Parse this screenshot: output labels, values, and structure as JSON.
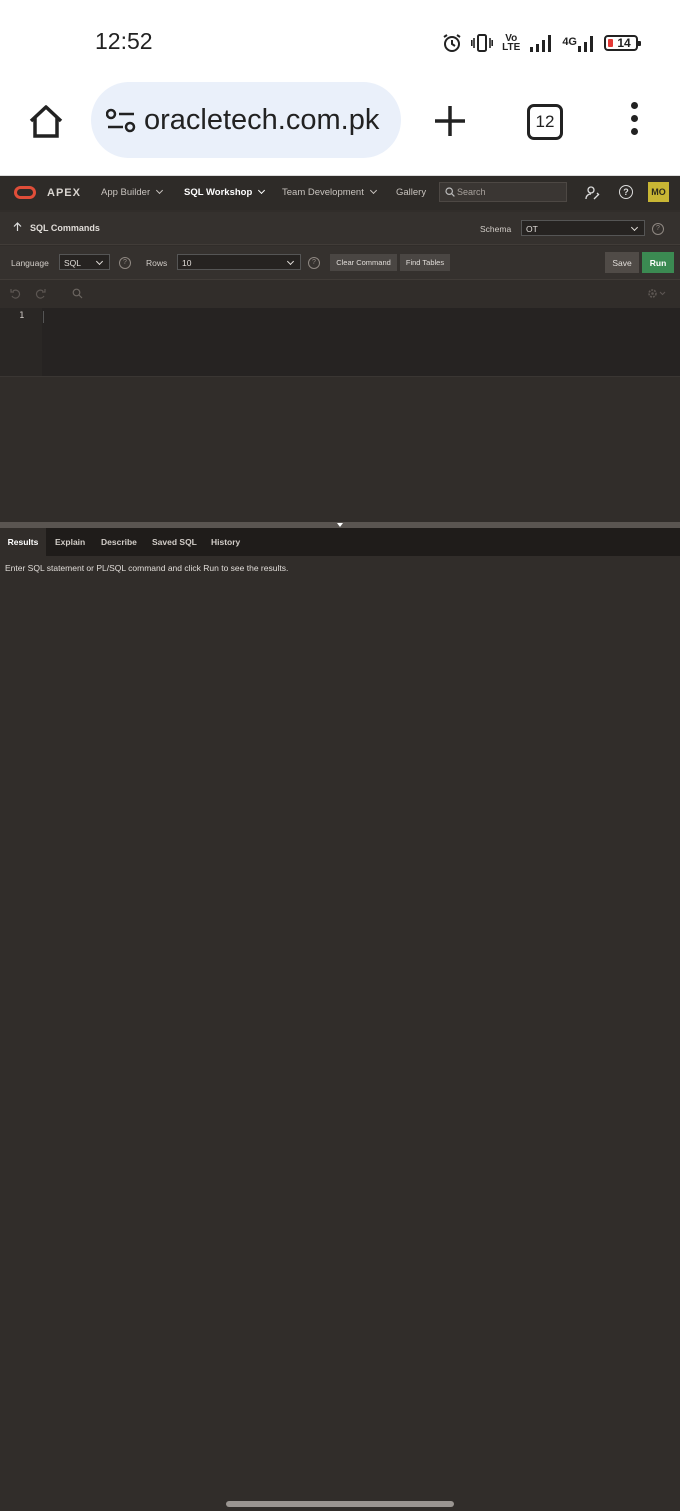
{
  "status_bar": {
    "time": "12:52",
    "volte_top": "Vo",
    "volte_bottom": "LTE",
    "network_type": "4G",
    "battery_level": "14",
    "icons": [
      "alarm-icon",
      "vibrate-icon",
      "volte-icon",
      "signal-icon",
      "network-4g-icon",
      "battery-icon"
    ]
  },
  "browser": {
    "url": "oracletech.com.pk",
    "tab_count": "12",
    "icons": [
      "home-icon",
      "site-settings-icon",
      "new-tab-icon",
      "tabs-icon",
      "menu-icon"
    ]
  },
  "header": {
    "product": "APEX",
    "nav": [
      {
        "label": "App Builder",
        "active": false
      },
      {
        "label": "SQL Workshop",
        "active": true
      },
      {
        "label": "Team Development",
        "active": false
      },
      {
        "label": "Gallery",
        "active": false
      }
    ],
    "search_placeholder": "Search",
    "avatar_initials": "MO",
    "accent_color": "#e04e39",
    "avatar_color": "#c8b634"
  },
  "page": {
    "title": "SQL Commands",
    "schema_label": "Schema",
    "schema_value": "OT"
  },
  "toolbar": {
    "language_label": "Language",
    "language_value": "SQL",
    "rows_label": "Rows",
    "rows_value": "10",
    "clear_label": "Clear Command",
    "find_label": "Find Tables",
    "save_label": "Save",
    "run_label": "Run",
    "run_color": "#3b8a52"
  },
  "editor": {
    "line_number": "1",
    "content": ""
  },
  "results": {
    "tabs": [
      {
        "label": "Results",
        "active": true
      },
      {
        "label": "Explain",
        "active": false
      },
      {
        "label": "Describe",
        "active": false
      },
      {
        "label": "Saved SQL",
        "active": false
      },
      {
        "label": "History",
        "active": false
      }
    ],
    "message": "Enter SQL statement or PL/SQL command and click Run to see the results."
  }
}
